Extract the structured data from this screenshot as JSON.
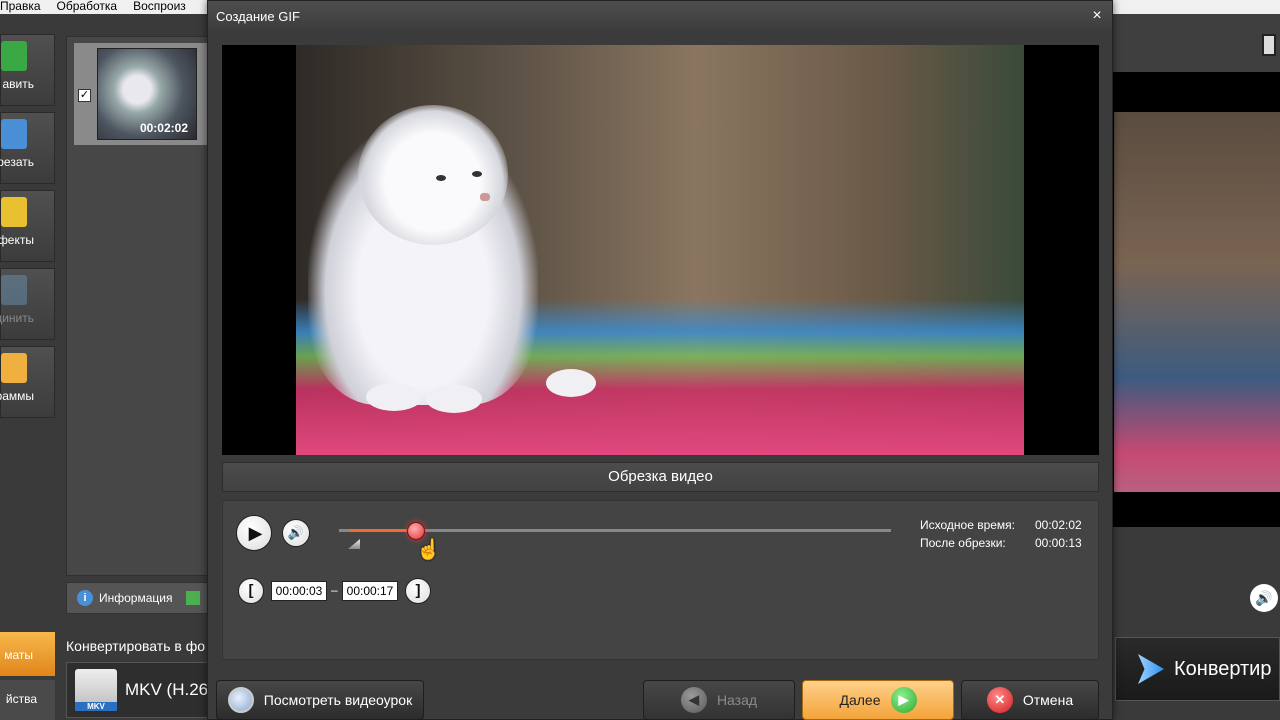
{
  "menubar": {
    "items": [
      "Правка",
      "Обработка",
      "Воспроиз"
    ]
  },
  "left_toolbar": {
    "items": [
      {
        "label": "авить",
        "icon": "add-video-icon",
        "color": "#3aa845"
      },
      {
        "label": "резать",
        "icon": "scissors-icon",
        "color": "#4a8fd6"
      },
      {
        "label": "фекты",
        "icon": "magic-wand-icon",
        "color": "#e8c030"
      },
      {
        "label": "динить",
        "icon": "merge-icon",
        "color": "#6a8fb0",
        "disabled": true
      },
      {
        "label": "траммы",
        "icon": "subtitles-icon",
        "color": "#f0b040"
      }
    ]
  },
  "files": {
    "thumb_time": "00:02:02",
    "checked": "✓"
  },
  "info_bar": {
    "label": "Информация"
  },
  "bottom_left": {
    "formats_tab": "маты",
    "props_tab": "йства",
    "convert_label": "Конвертировать в фо",
    "format_text": "MKV (H.26",
    "mkv_badge": "MKV"
  },
  "right_panel": {
    "convert_button": "Конвертир"
  },
  "dialog": {
    "title": "Создание GIF",
    "close": "×",
    "section_title": "Обрезка видео",
    "source_time_label": "Исходное время:",
    "source_time_value": "00:02:02",
    "after_trim_label": "После обрезки:",
    "after_trim_value": "00:00:13",
    "start_time": "00:00:03",
    "end_time": "00:00:17",
    "dash": "–",
    "trim_start_fraction": 0.02,
    "trim_end_fraction": 0.14,
    "buttons": {
      "tutorial": "Посмотреть видеоурок",
      "back": "Назад",
      "next": "Далее",
      "cancel": "Отмена"
    }
  },
  "colors": {
    "accent": "#f3a43a",
    "timeline_fill": "#f26a3a",
    "knob": "#e0303a"
  }
}
